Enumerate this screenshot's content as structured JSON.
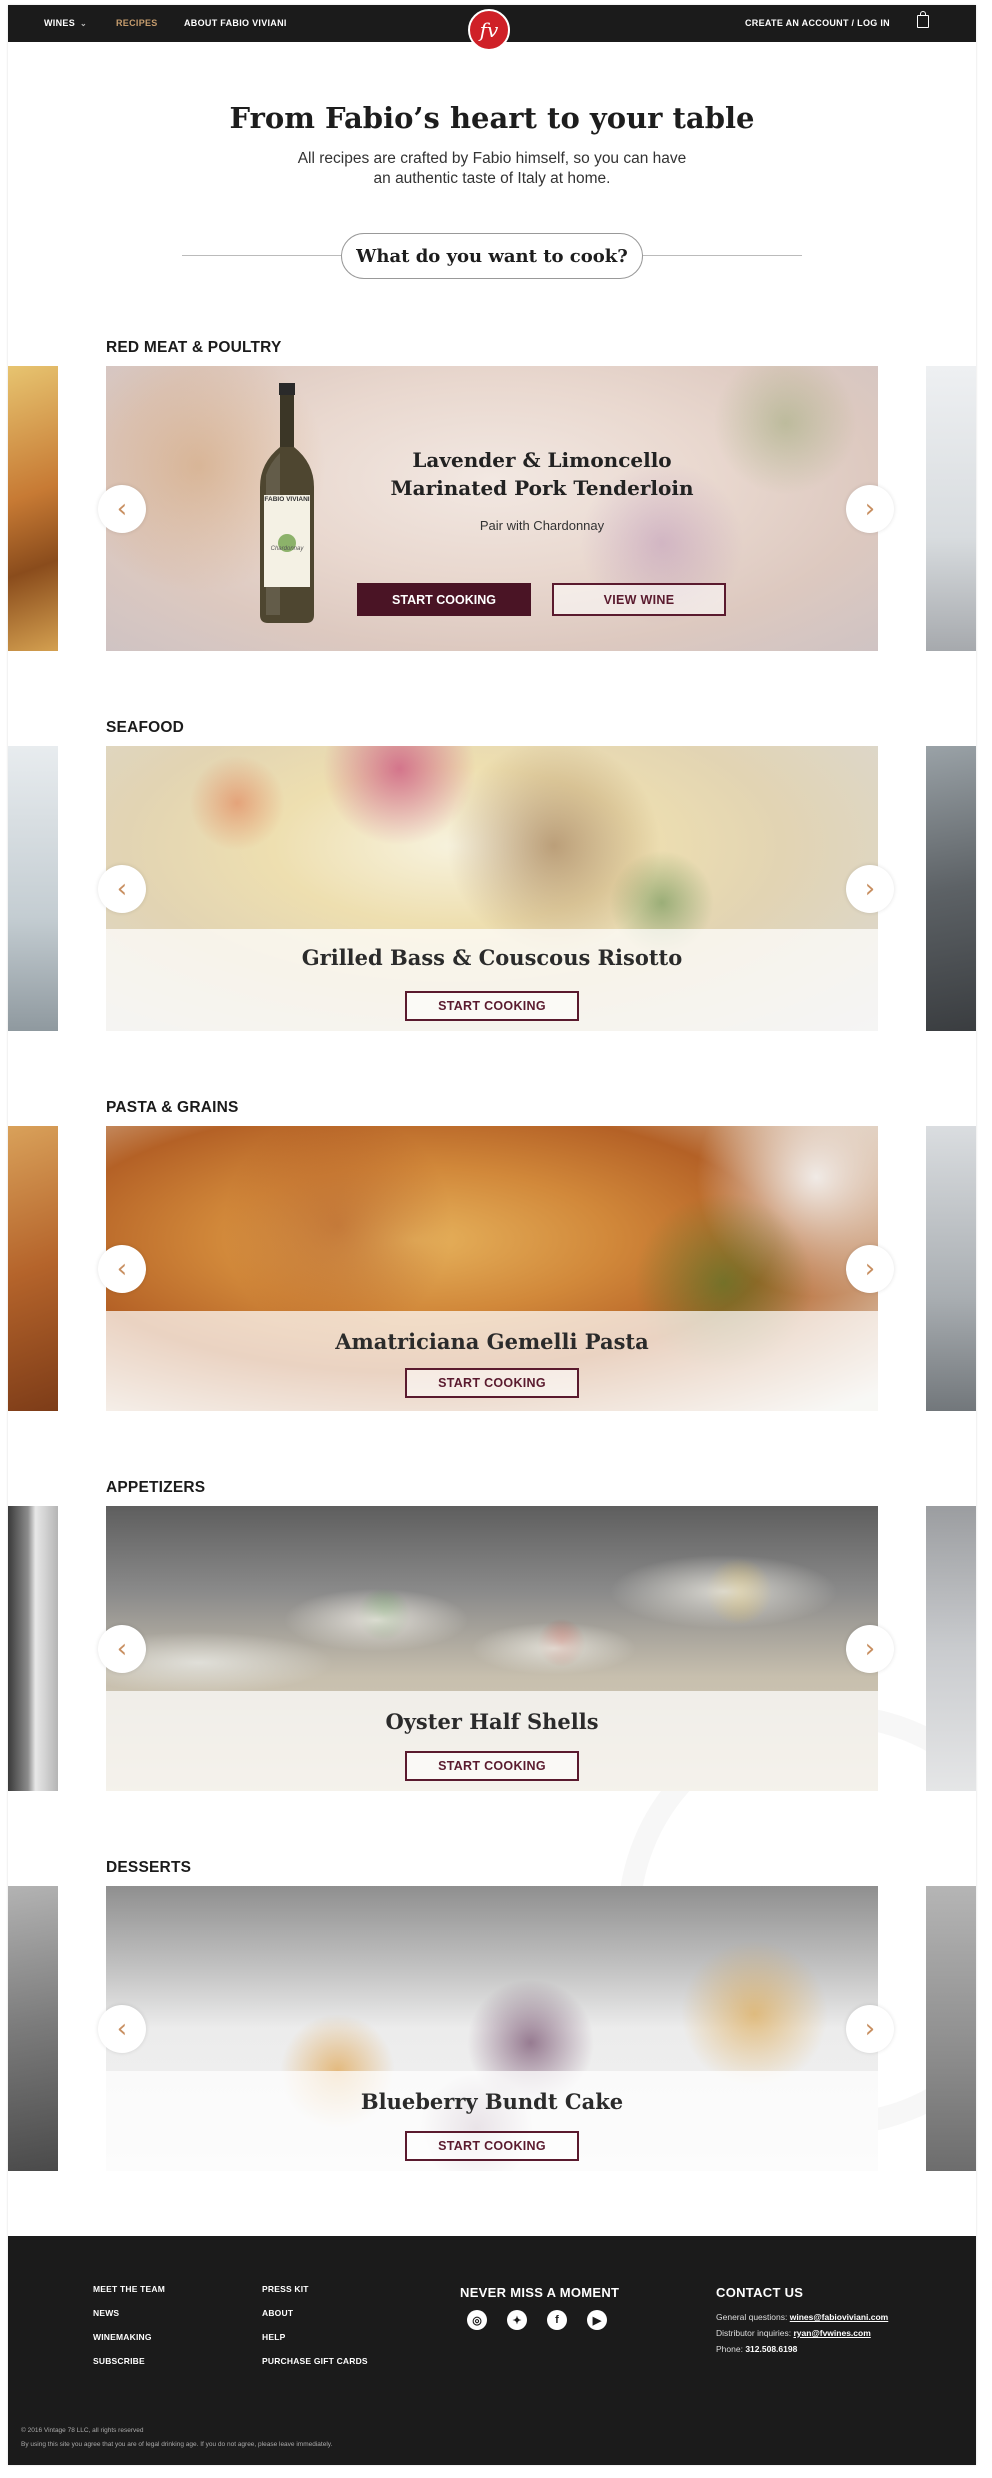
{
  "header": {
    "nav": [
      {
        "label": "WINES",
        "has_dropdown": true
      },
      {
        "label": "RECIPES",
        "active": true
      },
      {
        "label": "ABOUT FABIO VIVIANI"
      }
    ],
    "logo_text": "fv",
    "account_label": "CREATE AN ACCOUNT / LOG IN",
    "cart_icon": "shopping-bag-icon"
  },
  "hero": {
    "title": "From Fabio’s heart to your table",
    "subtitle": "All recipes are crafted by Fabio himself, so you can have an authentic taste of Italy at home.",
    "search_label": "What do you want to cook?"
  },
  "categories": [
    {
      "title": "RED MEAT & POULTRY",
      "recipe": "Lavender & Limoncello Marinated Pork Tenderloin",
      "pairing": "Pair with Chardonnay",
      "bottle_brand": "FABIO VIVIANI",
      "bottle_variety": "Chardonnay",
      "primary_button": "START COOKING",
      "secondary_button": "VIEW WINE"
    },
    {
      "title": "SEAFOOD",
      "recipe": "Grilled Bass & Couscous Risotto",
      "button": "START COOKING"
    },
    {
      "title": "PASTA & GRAINS",
      "recipe": "Amatriciana Gemelli Pasta",
      "button": "START COOKING"
    },
    {
      "title": "APPETIZERS",
      "recipe": "Oyster Half Shells",
      "button": "START COOKING"
    },
    {
      "title": "DESSERTS",
      "recipe": "Blueberry Bundt Cake",
      "button": "START COOKING"
    }
  ],
  "arrows": {
    "prev": "‹",
    "next": "›"
  },
  "footer": {
    "col1": [
      "MEET THE TEAM",
      "NEWS",
      "WINEMAKING",
      "SUBSCRIBE"
    ],
    "col2": [
      "PRESS KIT",
      "ABOUT",
      "HELP",
      "PURCHASE GIFT CARDS"
    ],
    "social_heading": "NEVER MISS A MOMENT",
    "social_icons": [
      "instagram-icon",
      "twitter-icon",
      "facebook-icon",
      "youtube-icon"
    ],
    "contact_heading": "CONTACT US",
    "contact": {
      "general_label": "General questions:",
      "general_email": "wines@fabioviviani.com",
      "distributor_label": "Distributor inquiries:",
      "distributor_email": "ryan@fvwines.com",
      "phone_label": "Phone:",
      "phone": "312.508.6198"
    },
    "copyright": "© 2016 Vintage 78 LLC, all rights reserved",
    "disclaimer": "By using this site you agree that you are of legal drinking age. If you do not agree, please leave immediately."
  }
}
